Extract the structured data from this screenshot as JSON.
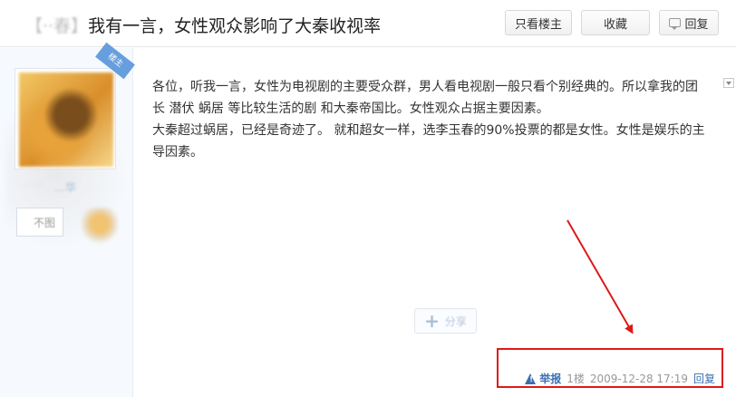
{
  "header": {
    "title_blurred": "【··春】",
    "title_text": "我有一言，女性观众影响了大秦收视率",
    "only_op_label": "只看楼主",
    "favorite_label": "收藏",
    "reply_label": "回复"
  },
  "sidebar": {
    "corner_badge": "楼主",
    "username_blurred": "…华",
    "follow_blurred": "不图"
  },
  "post": {
    "paragraphs": [
      "各位，听我一言，女性为电视剧的主要受众群，男人看电视剧一般只看个别经典的。所以拿我的团 长 潜伏 蜗居 等比较生活的剧 和大秦帝国比。女性观众占据主要因素。",
      "大秦超过蜗居，已经是奇迹了。 就和超女一样，选李玉春的90%投票的都是女性。女性是娱乐的主导因素。"
    ],
    "share_label": "分享"
  },
  "footer": {
    "report_label": "举报",
    "floor": "1楼",
    "time": "2009-12-28 17:19",
    "reply_label": "回复"
  },
  "colors": {
    "annotation": "#e01818",
    "link": "#3a6fb0",
    "sidebar_bg": "#f6f9fd"
  }
}
